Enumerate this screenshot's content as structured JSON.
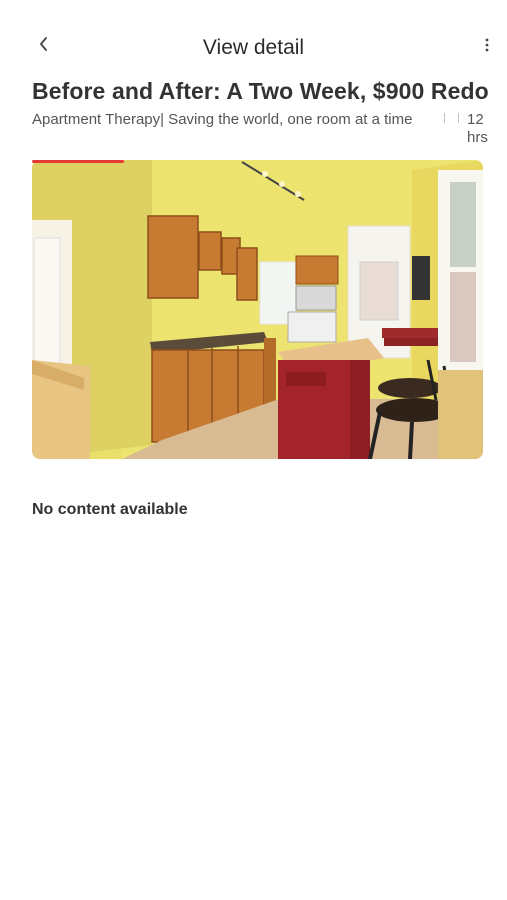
{
  "header": {
    "title": "View detail",
    "back_icon": "back-arrow-icon",
    "menu_icon": "more-vertical-icon"
  },
  "article": {
    "headline": "Before and After: A Two Week, $900 Redo",
    "source": "Apartment Therapy| Saving the world, one room at a time",
    "time_value": "12",
    "time_unit": "hrs",
    "image_alt": "Kitchen with yellow walls, wooden cabinets and a red island with bar stools"
  },
  "content": {
    "empty_message": "No content available"
  },
  "colors": {
    "accent": "#e53935",
    "text": "#333333",
    "muted": "#555555"
  }
}
